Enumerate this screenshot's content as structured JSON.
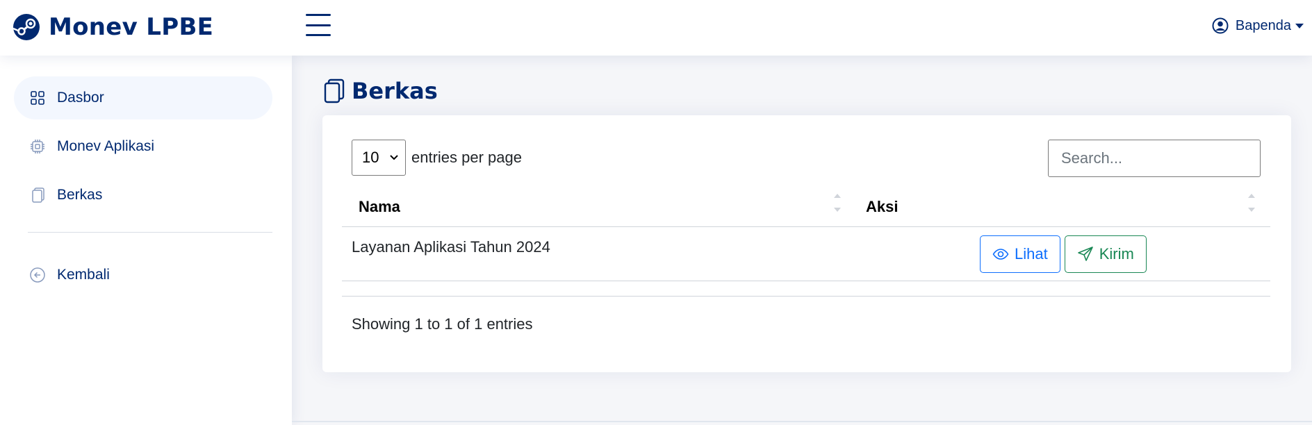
{
  "header": {
    "brand": "Monev LPBE",
    "user": "Bapenda"
  },
  "sidebar": {
    "items": [
      {
        "label": "Dasbor",
        "icon": "grid-icon",
        "active": true
      },
      {
        "label": "Monev Aplikasi",
        "icon": "cpu-icon",
        "active": false
      },
      {
        "label": "Berkas",
        "icon": "files-icon",
        "active": false
      }
    ],
    "back": {
      "label": "Kembali",
      "icon": "arrow-left-circle-icon"
    }
  },
  "main": {
    "title": "Berkas",
    "table": {
      "per_page": "10",
      "per_page_label": "entries per page",
      "search_placeholder": "Search...",
      "columns": [
        "Nama",
        "Aksi"
      ],
      "rows": [
        {
          "nama": "Layanan Aplikasi Tahun 2024",
          "view_label": "Lihat",
          "send_label": "Kirim"
        }
      ],
      "info": "Showing 1 to 1 of 1 entries"
    }
  },
  "colors": {
    "primary": "#012970",
    "view": "#0d6efd",
    "send": "#198754",
    "background": "#f5f6f9"
  }
}
